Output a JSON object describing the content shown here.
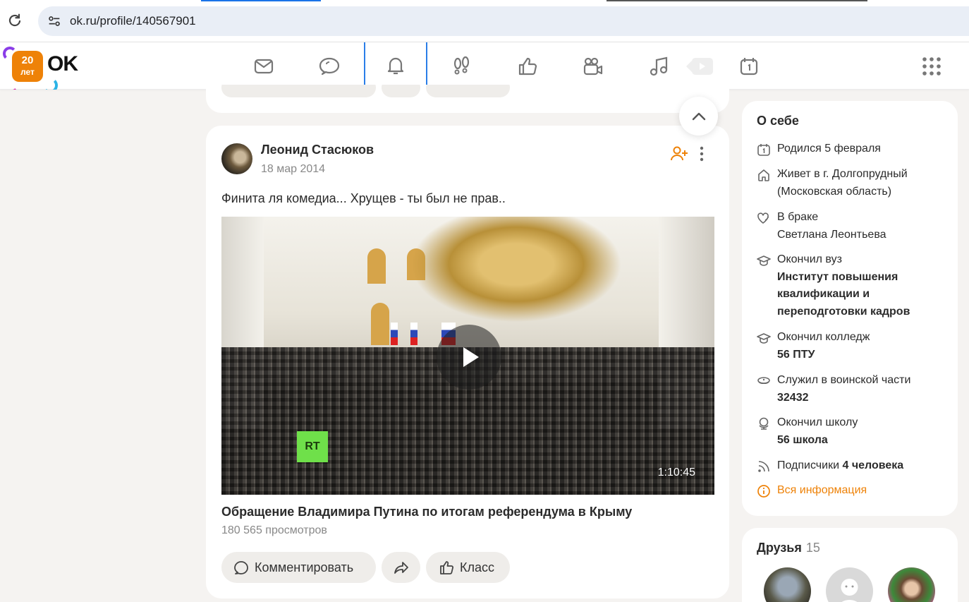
{
  "browser": {
    "url": "ok.ru/profile/140567901"
  },
  "logo": {
    "badge_top": "20",
    "badge_bottom": "лет",
    "text": "OK"
  },
  "nav": {
    "items": [
      "messages-icon",
      "discussions-icon",
      "notifications-icon",
      "guests-icon",
      "reactions-icon",
      "video-icon",
      "music-icon",
      "video-play-icon",
      "calendar-icon"
    ],
    "active": "notifications-icon"
  },
  "colors": {
    "accent": "#ee8208",
    "active_tab": "#2a7ee8",
    "card": "#ffffff",
    "page_bg": "#f5f3f1"
  },
  "post": {
    "author": "Леонид Стасюков",
    "date": "18 мар 2014",
    "text": "Финита ля комедиа... Хрущев - ты был не прав..",
    "video": {
      "duration": "1:10:45",
      "title": "Обращение Владимира Путина по итогам референдума в Крыму",
      "views": "180 565 просмотров",
      "watermark": "RT"
    },
    "actions": {
      "comment": "Комментировать",
      "like": "Класс"
    }
  },
  "about": {
    "title": "О себе",
    "born": "Родился 5 февраля",
    "lives_label": "Живет в г. Долгопрудный",
    "lives_region": "(Московская область)",
    "marriage_label": "В браке",
    "marriage_spouse": "Светлана Леонтьева",
    "university_label": "Окончил вуз",
    "university_name": "Институт повышения квалификации и переподготовки кадров",
    "college_label": "Окончил колледж",
    "college_name": "56 ПТУ",
    "military_label": "Служил в воинской части",
    "military_unit": "32432",
    "school_label": "Окончил школу",
    "school_name": "56 школа",
    "subscribers_label": "Подписчики",
    "subscribers_value": "4 человека",
    "all_info": "Вся информация"
  },
  "friends": {
    "title": "Друзья",
    "count": "15"
  }
}
